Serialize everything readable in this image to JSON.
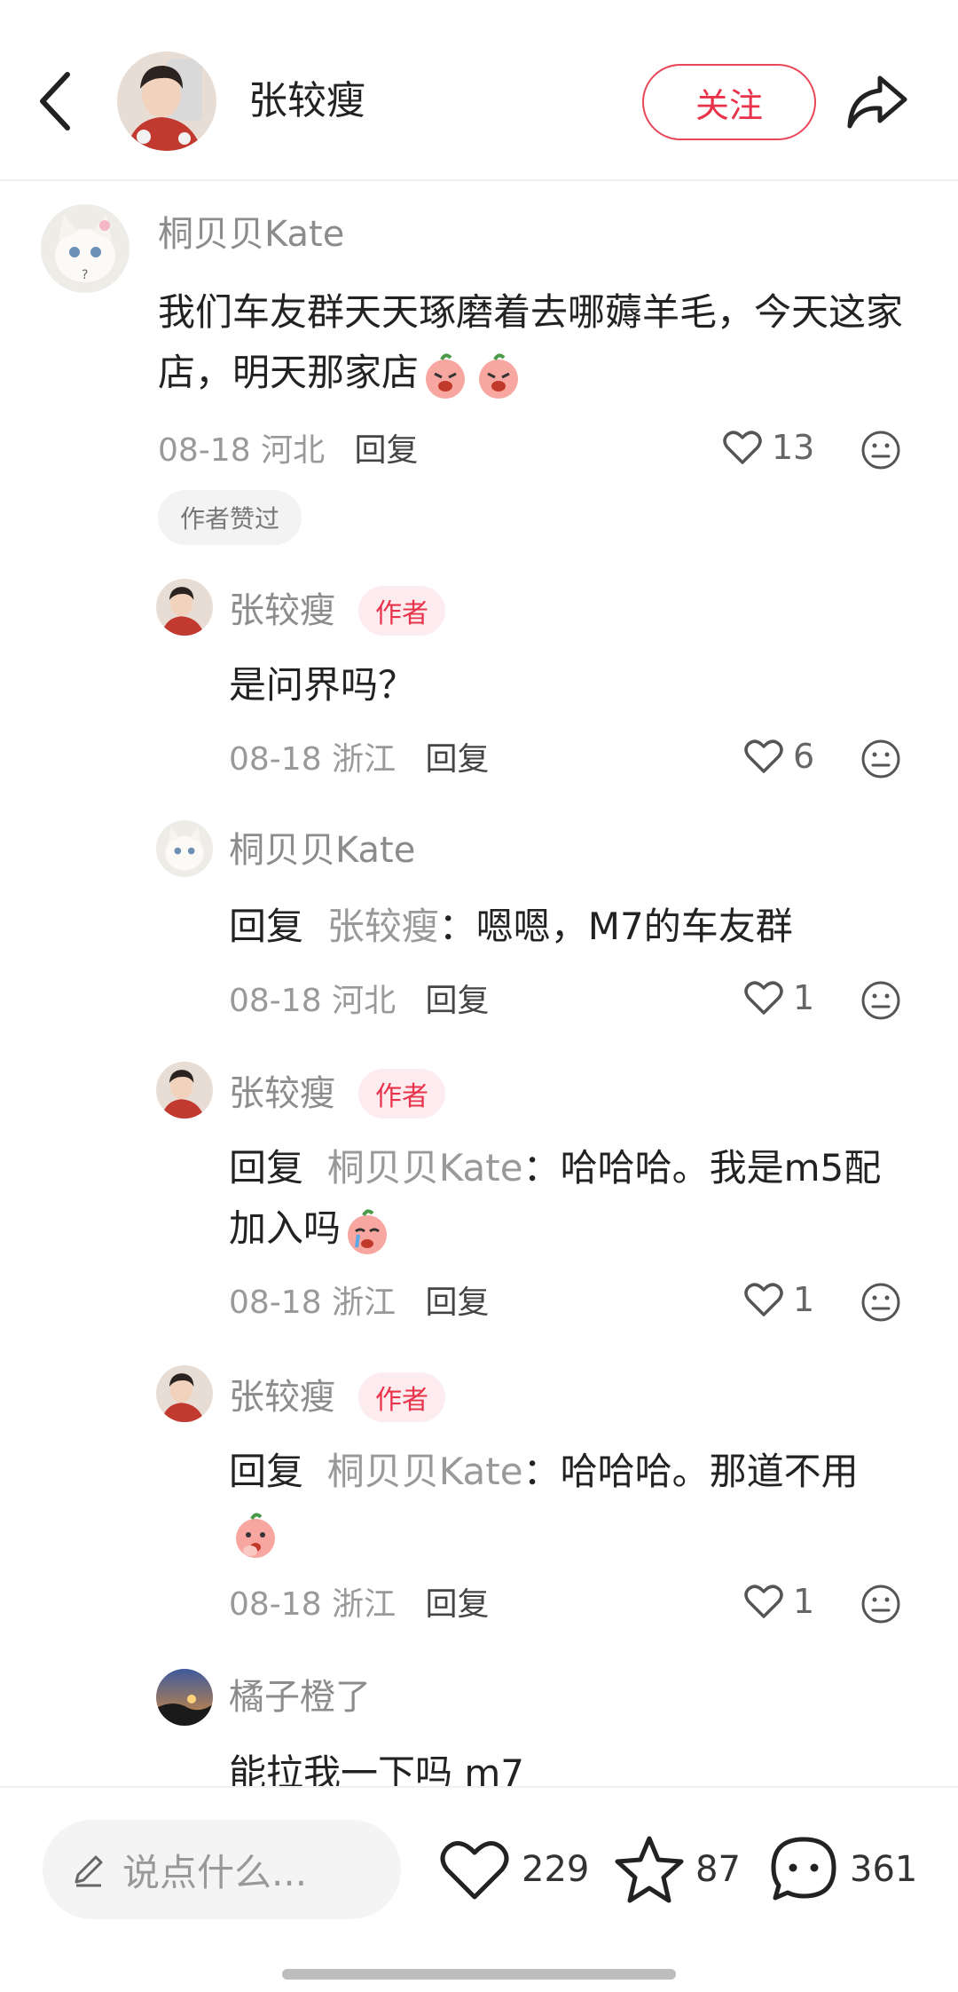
{
  "header": {
    "author_name": "张较瘦",
    "follow_label": "关注"
  },
  "colors": {
    "accent": "#e8334a",
    "muted_text": "#999999"
  },
  "comments": [
    {
      "user": "桐贝贝Kate",
      "text": "我们车友群天天琢磨着去哪薅羊毛，今天这家店，明天那家店",
      "emojis": [
        "angry-peach-emoji",
        "angry-peach-emoji"
      ],
      "date": "08-18",
      "location": "河北",
      "reply_label": "回复",
      "likes": "13",
      "liked_tag": "作者赞过"
    },
    {
      "user": "张较瘦",
      "badge": "作者",
      "text": "是问界吗？",
      "date": "08-18",
      "location": "浙江",
      "reply_label": "回复",
      "likes": "6"
    },
    {
      "user": "桐贝贝Kate",
      "prefix": "回复",
      "mention": "张较瘦",
      "text": "：嗯嗯，M7的车友群",
      "date": "08-18",
      "location": "河北",
      "reply_label": "回复",
      "likes": "1"
    },
    {
      "user": "张较瘦",
      "badge": "作者",
      "prefix": "回复",
      "mention": "桐贝贝Kate",
      "text": "：哈哈哈。我是m5配加入吗",
      "emojis": [
        "crying-peach-emoji"
      ],
      "date": "08-18",
      "location": "浙江",
      "reply_label": "回复",
      "likes": "1"
    },
    {
      "user": "张较瘦",
      "badge": "作者",
      "prefix": "回复",
      "mention": "桐贝贝Kate",
      "text": "：哈哈哈。那道不用",
      "emojis": [
        "shy-peach-emoji"
      ],
      "date": "08-18",
      "location": "浙江",
      "reply_label": "回复",
      "likes": "1"
    },
    {
      "user": "橘子橙了",
      "text": "能拉我一下吗 m7"
    }
  ],
  "bottom_bar": {
    "input_placeholder": "说点什么...",
    "likes": "229",
    "collects": "87",
    "comments": "361"
  }
}
